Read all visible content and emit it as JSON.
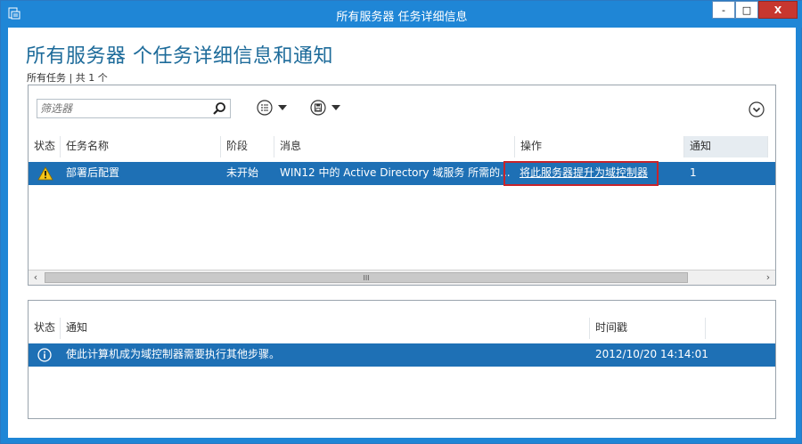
{
  "window": {
    "title": "所有服务器 任务详细信息",
    "controls": {
      "minimize": "-",
      "maximize": "□",
      "close": "X"
    }
  },
  "page": {
    "title": "所有服务器 个任务详细信息和通知",
    "subinfo": "所有任务 | 共 1 个"
  },
  "tasks_panel": {
    "filter_placeholder": "筛选器",
    "columns": [
      "状态",
      "任务名称",
      "阶段",
      "消息",
      "操作",
      "通知"
    ],
    "rows": [
      {
        "status_icon": "warning-icon",
        "task_name": "部署后配置",
        "stage": "未开始",
        "message": "WIN12 中的 Active Directory 域服务 所需的...",
        "action": "将此服务器提升为域控制器",
        "notification": "1"
      }
    ],
    "scroll_thumb_glyph": "III"
  },
  "notifications_panel": {
    "columns": [
      "状态",
      "通知",
      "时间戳"
    ],
    "rows": [
      {
        "status_icon": "info-icon",
        "notification": "使此计算机成为域控制器需要执行其他步骤。",
        "timestamp": "2012/10/20 14:14:01"
      }
    ]
  },
  "colors": {
    "titlebar": "#1f86d6",
    "selected_row": "#1e70b5",
    "title_text": "#1d6b9a",
    "highlight_box": "#c8242a"
  }
}
